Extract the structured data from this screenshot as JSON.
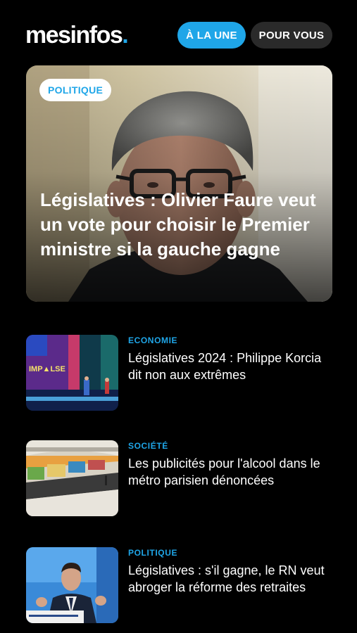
{
  "header": {
    "logo_text": "mesinfos",
    "logo_dot": ".",
    "tabs": [
      {
        "label": "À LA UNE",
        "active": true
      },
      {
        "label": "POUR VOUS",
        "active": false
      }
    ]
  },
  "hero": {
    "category": "POLITIQUE",
    "title": "Législatives : Olivier Faure veut un vote pour choisir le Premier ministre si la gauche gagne"
  },
  "articles": [
    {
      "category": "ECONOMIE",
      "title": "Législatives 2024 : Philippe Korcia dit non aux extrêmes",
      "thumb_icon": "conference-stage-photo"
    },
    {
      "category": "SOCIÉTÉ",
      "title": "Les publicités pour l'alcool dans le métro parisien dénoncées",
      "thumb_icon": "metro-station-photo"
    },
    {
      "category": "POLITIQUE",
      "title": "Législatives : s'il gagne, le RN veut abroger la réforme des retraites",
      "thumb_icon": "politician-speech-photo"
    }
  ],
  "colors": {
    "accent": "#1fa6e8",
    "background": "#000000",
    "tab_inactive": "#2a2a2a"
  }
}
